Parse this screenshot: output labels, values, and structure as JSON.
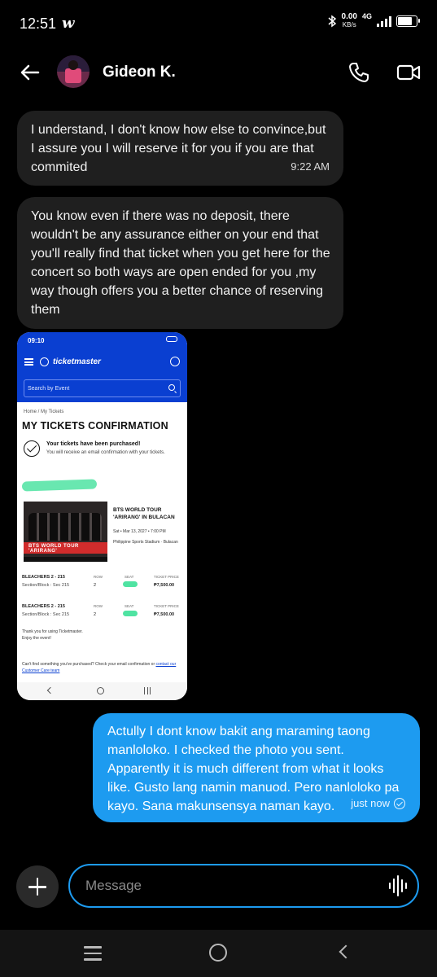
{
  "status_bar": {
    "time": "12:51",
    "app_glyph": "w",
    "net_speed_value": "0.00",
    "net_speed_unit": "KB/s",
    "network_type": "4G",
    "battery_level": 0.8
  },
  "header": {
    "contact_name": "Gideon K.",
    "back_icon": "arrow-left-icon",
    "call_icon": "phone-icon",
    "video_icon": "video-icon"
  },
  "messages": [
    {
      "direction": "incoming",
      "text": "I understand, I don't know how else to convince,but I assure you I will reserve it for you if you are that commited",
      "time": "9:22 AM"
    },
    {
      "direction": "incoming",
      "text": "You know even if there was no deposit, there wouldn't be any assurance either on your end that you'll really find that ticket when you get here for the concert so both ways are open ended for you ,my way though offers you a better chance of reserving them",
      "time": ""
    },
    {
      "direction": "outgoing",
      "text": "Actully I dont know bakit ang maraming taong manloloko. I checked the photo you sent. Apparently it is much different from what it looks like. Gusto lang namin manuod. Pero nanloloko pa kayo. Sana makunsensya naman kayo.",
      "time": "just now"
    }
  ],
  "attachment": {
    "status_time": "09:10",
    "brand": "ticketmaster",
    "search_placeholder": "Search by Event",
    "breadcrumb": "Home  /  My Tickets",
    "page_title": "MY TICKETS CONFIRMATION",
    "confirm_title": "Your tickets have been purchased!",
    "confirm_sub": "You will receive an email confirmation with your tickets.",
    "poster_text": "BTS WORLD TOUR 'ARIRANG'",
    "event_title": "BTS WORLD TOUR 'ARIRANG' IN BULACAN",
    "event_date": "Sat • Mar 13, 2027 • 7:00 PM",
    "event_venue": "Philippine Sports Stadium · Bulacan",
    "tickets": [
      {
        "section": "BLEACHERS 2 - 215",
        "block": "Section/Block : Sec 215",
        "row_label": "ROW",
        "row": "2",
        "seat_label": "SEAT",
        "price_label": "TICKET PRICE",
        "price": "₱7,500.00"
      },
      {
        "section": "BLEACHERS 2 - 215",
        "block": "Section/Block : Sec 215",
        "row_label": "ROW",
        "row": "2",
        "seat_label": "SEAT",
        "price_label": "TICKET PRICE",
        "price": "₱7,500.00"
      }
    ],
    "thanks_line1": "Thank you for using Ticketmaster.",
    "thanks_line2": "Enjoy the event!",
    "help_text": "Can't find something you've purchased? Check your email confirmation or",
    "help_link": "contact our Customer Care team"
  },
  "composer": {
    "placeholder": "Message",
    "add_icon": "plus-icon",
    "voice_icon": "waveform-icon"
  },
  "colors": {
    "outgoing_bubble": "#1d9bf0",
    "incoming_bubble": "#1f1f1f",
    "ticketmaster_blue": "#0a3fd1",
    "redaction_green": "#4fe3a2"
  }
}
